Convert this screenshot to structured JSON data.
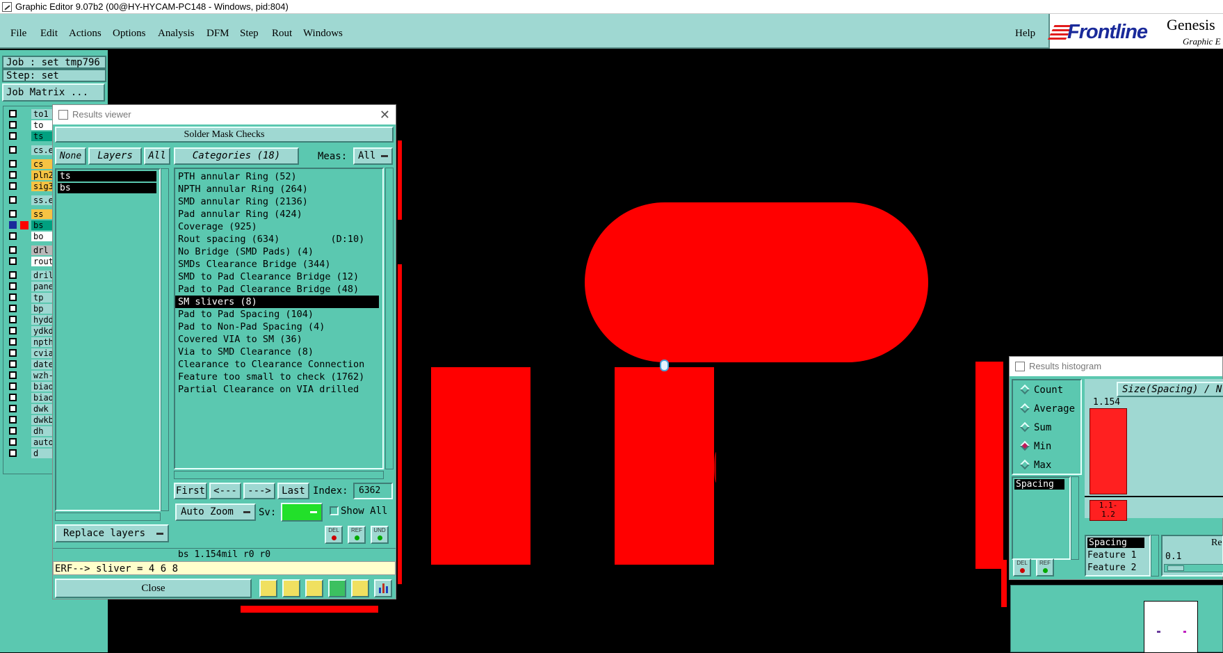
{
  "window": {
    "title": "Graphic Editor 9.07b2 (00@HY-HYCAM-PC148 - Windows, pid:804)"
  },
  "menu": {
    "items": [
      "File",
      "Edit",
      "Actions",
      "Options",
      "Analysis",
      "DFM",
      "Step",
      "Rout",
      "Windows"
    ],
    "help": "Help"
  },
  "logo": {
    "brand": "Frontline",
    "product": "Genesis",
    "sub": "Graphic E"
  },
  "job": {
    "job_label": "Job : set_tmp796",
    "step_label": "Step: set",
    "matrix_button": "Job Matrix ..."
  },
  "layers": [
    {
      "name": "to1",
      "color": "#9fd8d2"
    },
    {
      "name": "to",
      "color": "#ffffff"
    },
    {
      "name": "ts",
      "color": "#00a080"
    },
    {
      "name": "cs.et",
      "color": "#9fd8d2"
    },
    {
      "name": "cs",
      "color": "#f6c343"
    },
    {
      "name": "pln2",
      "color": "#f6c343"
    },
    {
      "name": "sig3",
      "color": "#f6c343"
    },
    {
      "name": "ss.et",
      "color": "#9fd8d2"
    },
    {
      "name": "ss",
      "color": "#f6c343"
    },
    {
      "name": "bs",
      "color": "#00a080"
    },
    {
      "name": "bo",
      "color": "#ffffff"
    },
    {
      "name": "drl",
      "color": "#b9b9b9"
    },
    {
      "name": "rout",
      "color": "#ffffff"
    },
    {
      "name": "drill",
      "color": "#9fd8d2"
    },
    {
      "name": "panel",
      "color": "#9fd8d2"
    },
    {
      "name": "tp",
      "color": "#9fd8d2"
    },
    {
      "name": "bp",
      "color": "#9fd8d2"
    },
    {
      "name": "hydd",
      "color": "#9fd8d2"
    },
    {
      "name": "ydkd",
      "color": "#9fd8d2"
    },
    {
      "name": "npth",
      "color": "#9fd8d2"
    },
    {
      "name": "cvia",
      "color": "#9fd8d2"
    },
    {
      "name": "dated",
      "color": "#9fd8d2"
    },
    {
      "name": "wzh-h",
      "color": "#9fd8d2"
    },
    {
      "name": "biaoz",
      "color": "#9fd8d2"
    },
    {
      "name": "biaoz",
      "color": "#9fd8d2"
    },
    {
      "name": "dwk",
      "color": "#9fd8d2"
    },
    {
      "name": "dwkby",
      "color": "#9fd8d2"
    },
    {
      "name": "dh",
      "color": "#9fd8d2"
    },
    {
      "name": "auto_",
      "color": "#9fd8d2"
    },
    {
      "name": "d",
      "color": "#9fd8d2"
    }
  ],
  "results_viewer": {
    "title": "Results viewer",
    "header": "Solder Mask Checks",
    "none_btn": "None",
    "layers_btn": "Layers",
    "all_btn": "All",
    "layer_items": [
      "ts",
      "bs"
    ],
    "categories_btn": "Categories (18)",
    "meas_label": "Meas:",
    "meas_value": "All",
    "categories": [
      "PTH annular Ring (52)",
      "NPTH annular Ring (264)",
      "SMD annular Ring (2136)",
      "Pad annular Ring (424)",
      "Coverage (925)",
      "Rout spacing (634)         (D:10)",
      "No Bridge (SMD Pads) (4)",
      "SMDs Clearance Bridge (344)",
      "SMD to Pad Clearance Bridge (12)",
      "Pad to Pad Clearance Bridge (48)",
      "SM slivers (8)",
      "Pad to Pad Spacing (104)",
      "Pad to Non-Pad Spacing (4)",
      "Covered VIA to SM (36)",
      "Via to SMD Clearance (8)",
      "Clearance to Clearance Connection",
      "Feature too small to check (1762)",
      "Partial Clearance on VIA drilled"
    ],
    "selected_index": 10,
    "first_btn": "First",
    "prev_btn": "<---",
    "next_btn": "--->",
    "last_btn": "Last",
    "index_label": "Index:",
    "index_value": "6362",
    "auto_zoom": "Auto Zoom",
    "sv_label": "Sv:",
    "show_all": "Show All",
    "replace_layers": "Replace layers",
    "status": "bs 1.154mil  r0  r0",
    "erf": "ERF--> sliver = 4 6 8",
    "close": "Close",
    "del_label": "DEL",
    "ref_label": "REF",
    "und_label": "UND"
  },
  "histogram": {
    "title": "Results histogram",
    "options": [
      "Count",
      "Average",
      "Sum",
      "Min",
      "Max"
    ],
    "selected": "Min",
    "list_item": "Spacing",
    "chart_title": "Size(Spacing) / N",
    "bar_value": "1.154",
    "bar_range": "1.1-\n1.2",
    "bottom_items": [
      "Spacing",
      "Feature 1",
      "Feature 2"
    ],
    "re_label": "Re",
    "scale_value": "0.1",
    "del_label": "DEL",
    "ref_label": "REF"
  }
}
